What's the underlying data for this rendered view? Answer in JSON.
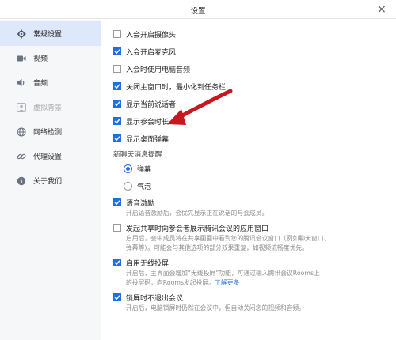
{
  "window": {
    "title": "设置"
  },
  "sidebar": {
    "items": [
      {
        "label": "常规设置",
        "icon": "gear-icon",
        "active": true
      },
      {
        "label": "视频",
        "icon": "video-camera-icon"
      },
      {
        "label": "音频",
        "icon": "speaker-icon"
      },
      {
        "label": "虚拟背景",
        "icon": "person-icon",
        "disabled": true
      },
      {
        "label": "网络检测",
        "icon": "globe-icon"
      },
      {
        "label": "代理设置",
        "icon": "link-icon"
      },
      {
        "label": "关于我们",
        "icon": "info-icon"
      }
    ]
  },
  "general": {
    "options": [
      {
        "label": "入会开启摄像头",
        "checked": false
      },
      {
        "label": "入会开启麦克风",
        "checked": true
      },
      {
        "label": "入会时使用电脑音频",
        "checked": false
      },
      {
        "label": "关闭主窗口时，最小化到任务栏",
        "checked": true
      },
      {
        "label": "显示当前说话者",
        "checked": true
      },
      {
        "label": "显示参会时长",
        "checked": true
      },
      {
        "label": "显示桌面弹幕",
        "checked": true
      }
    ],
    "chat_reminder": {
      "label": "新聊天消息提醒",
      "options": [
        {
          "label": "弹幕",
          "selected": true
        },
        {
          "label": "气泡",
          "selected": false
        }
      ]
    },
    "voice_motivation": {
      "label": "语音激励",
      "checked": true,
      "desc": "开启语音激励后，会优先显示正在说话的与会成员。"
    },
    "share_window": {
      "label": "发起共享时向参会者展示腾讯会议的应用窗口",
      "checked": false,
      "desc_line1": "启用后，会中成员将在共享画面中看到您的腾讯会议窗口（例如聊天窗口、",
      "desc_line2": "弹幕等）。可能会与其他选项的部分效果重复，如视频流畅度优先。"
    },
    "wireless_cast": {
      "label": "启用无线投屏",
      "checked": true,
      "desc_line1": "开启后，主界面会增加“无线投屏”功能，可通过输入腾讯会议Rooms上",
      "desc_line2": "的投屏码，向Rooms发起投屏。",
      "link": "了解更多"
    },
    "lock_screen": {
      "label": "锁屏时不退出会议",
      "checked": true,
      "desc": "开启后，电脑锁屏时仍然在会议中，但自动关闭您的视频和音频。"
    }
  },
  "colors": {
    "accent": "#1f6fe4",
    "arrow": "#c8171e",
    "sidebar_active": "#dde8fb"
  }
}
